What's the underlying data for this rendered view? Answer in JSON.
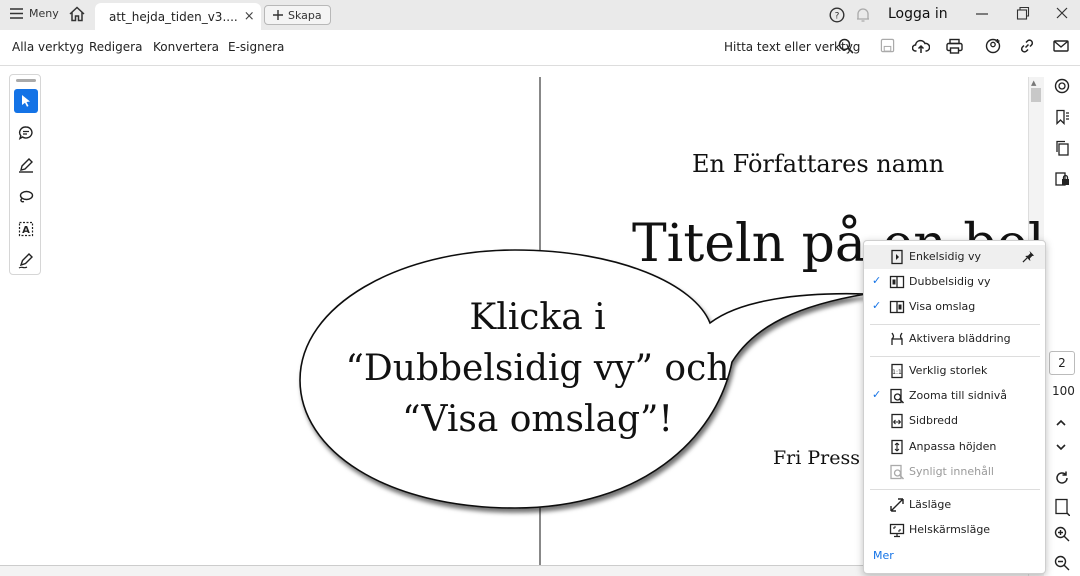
{
  "titlebar": {
    "menu_label": "Meny",
    "tab_title": "att_hejda_tiden_v3....",
    "tab_close": "×",
    "create_label": "Skapa",
    "login_label": "Logga in",
    "icons": {
      "menu": "hamburger-icon",
      "home": "home-icon",
      "star": "star-icon",
      "help": "help-icon",
      "bell": "bell-icon"
    }
  },
  "toolbar": {
    "items": [
      "Alla verktyg",
      "Redigera",
      "Konvertera",
      "E-signera"
    ],
    "find_label": "Hitta text eller verktyg"
  },
  "document": {
    "author": "En Författares namn",
    "title": "Titeln på en bok",
    "publisher": "Fri Press",
    "callout_lines": [
      "Klicka i",
      "“Dubbelsidig vy” och",
      "“Visa omslag”!"
    ]
  },
  "right_rail": {
    "page_number": "2",
    "zoom": "100"
  },
  "view_menu": {
    "items": [
      {
        "label": "Enkelsidig vy",
        "checked": false,
        "highlighted": true
      },
      {
        "label": "Dubbelsidig vy",
        "checked": true
      },
      {
        "label": "Visa omslag",
        "checked": true
      },
      {
        "label": "Aktivera bläddring",
        "checked": false
      },
      {
        "label": "Verklig storlek",
        "checked": false
      },
      {
        "label": "Zooma till sidnivå",
        "checked": true
      },
      {
        "label": "Sidbredd",
        "checked": false
      },
      {
        "label": "Anpassa höjden",
        "checked": false
      },
      {
        "label": "Synligt innehåll",
        "checked": false,
        "disabled": true
      },
      {
        "label": "Läsläge",
        "checked": false
      },
      {
        "label": "Helskärmsläge",
        "checked": false
      }
    ],
    "check_glyph": "✓",
    "more_label": "Mer"
  },
  "colors": {
    "accent": "#1473e6",
    "titlebar": "#eaeaea"
  }
}
